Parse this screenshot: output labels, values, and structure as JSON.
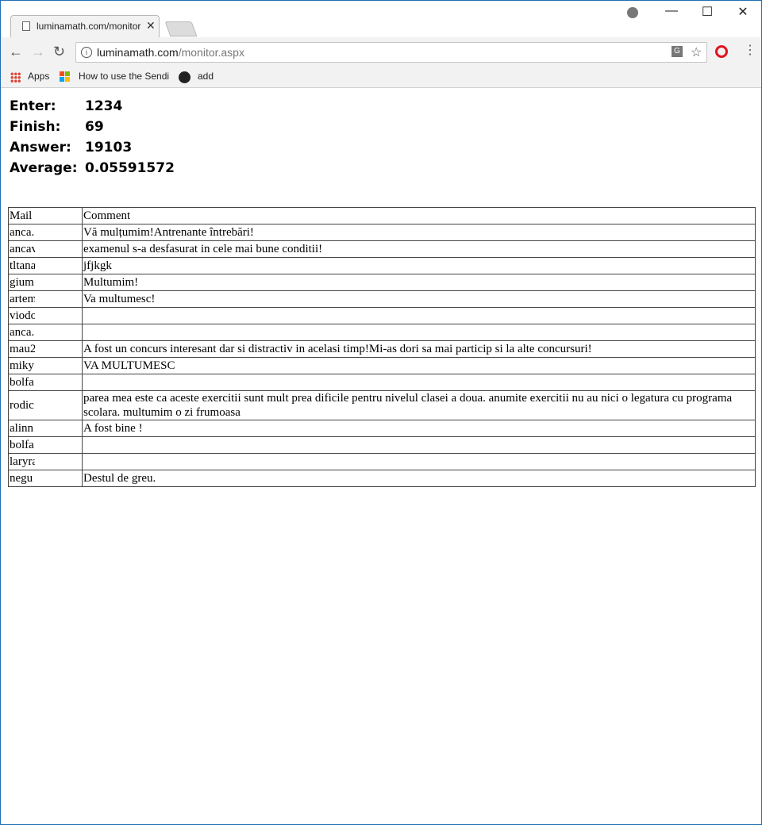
{
  "browser": {
    "tab_title": "luminamath.com/monitor",
    "tab_close": "✕",
    "url_host": "luminamath.com",
    "url_path": "/monitor.aspx",
    "window_controls": {
      "minimize": "—",
      "maximize": "☐",
      "close": "✕"
    },
    "nav": {
      "back": "←",
      "forward": "→",
      "reload": "↻"
    },
    "bookmarks": {
      "apps": "Apps",
      "item1": "How to use the Sendi",
      "item2": "add"
    }
  },
  "stats": {
    "enter_label": "Enter:",
    "enter_value": "1234",
    "finish_label": "Finish:",
    "finish_value": "69",
    "answer_label": "Answer:",
    "answer_value": "19103",
    "average_label": "Average:",
    "average_value": "0.05591572"
  },
  "table": {
    "headers": {
      "mail": "Mail",
      "comment": "Comment"
    },
    "rows": [
      {
        "mail": "anca.",
        "comment": "Vă mulțumim!Antrenante întrebări!"
      },
      {
        "mail": "ancav",
        "comment": "examenul s-a desfasurat in cele mai bune conditii!"
      },
      {
        "mail": "tltana",
        "comment": "jfjkgk"
      },
      {
        "mail": "gium",
        "comment": "Multumim!"
      },
      {
        "mail": "artem",
        "comment": "Va multumesc!"
      },
      {
        "mail": "viodo",
        "comment": ""
      },
      {
        "mail": "anca.",
        "comment": ""
      },
      {
        "mail": "mau2",
        "comment": "A fost un concurs interesant dar si distractiv in acelasi timp!Mi-as dori sa mai particip si la alte concursuri!"
      },
      {
        "mail": "miky",
        "comment": "VA MULTUMESC"
      },
      {
        "mail": "bolfa",
        "comment": ""
      },
      {
        "mail": "rodic",
        "comment": "parea mea este ca aceste exercitii sunt mult prea dificile pentru nivelul clasei a doua. anumite exercitii nu au nici o legatura cu programa scolara. multumim o zi frumoasa"
      },
      {
        "mail": "alinn",
        "comment": "A fost bine !"
      },
      {
        "mail": "bolfa",
        "comment": ""
      },
      {
        "mail": "laryra",
        "comment": ""
      },
      {
        "mail": "negu",
        "comment": "Destul de greu."
      }
    ]
  }
}
